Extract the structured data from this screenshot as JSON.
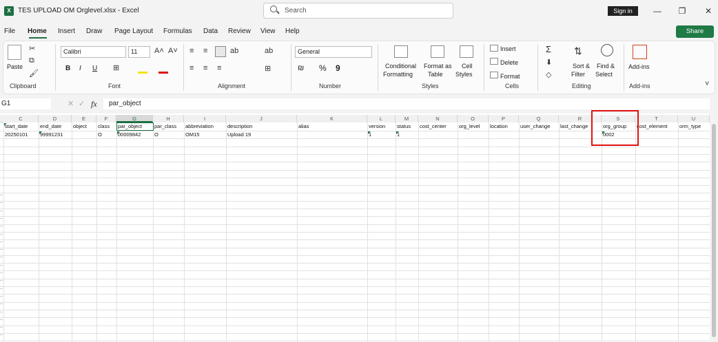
{
  "title_bar": {
    "logo": "X",
    "document_title": "TES UPLOAD OM Orglevel.xlsx  -  Excel",
    "search_placeholder": "Search",
    "sign_in": "Sign in",
    "minimize": "—",
    "restore": "❐",
    "close": "✕"
  },
  "menu": {
    "items": [
      "File",
      "Home",
      "Insert",
      "Draw",
      "Page Layout",
      "Formulas",
      "Data",
      "Review",
      "View",
      "Help"
    ],
    "share": "Share"
  },
  "ribbon": {
    "clipboard": {
      "label": "Clipboard",
      "paste": "Paste"
    },
    "font": {
      "label": "Font",
      "font_name": "Calibri",
      "font_size": "11",
      "bold": "B",
      "italic": "I",
      "underline": "U"
    },
    "alignment": {
      "label": "Alignment"
    },
    "number": {
      "label": "Number",
      "format": "General",
      "percent": "%",
      "comma": "9"
    },
    "styles": {
      "label": "Styles",
      "conditional": "Conditional",
      "formatting": "Formatting",
      "format_as": "Format as",
      "table": "Table",
      "cell": "Cell",
      "cell_styles": "Styles"
    },
    "cells": {
      "label": "Cells",
      "insert": "Insert",
      "delete": "Delete",
      "format": "Format"
    },
    "editing": {
      "label": "Editing",
      "sort": "Sort &",
      "filter": "Filter",
      "find": "Find &",
      "select": "Select"
    },
    "addins": {
      "label": "Add-ins",
      "button": "Add-ins"
    }
  },
  "formula_bar": {
    "name_box": "G1",
    "fx": "fx",
    "content": "par_object"
  },
  "columns": [
    "C",
    "D",
    "E",
    "F",
    "G",
    "H",
    "I",
    "J",
    "K",
    "L",
    "M",
    "N",
    "O",
    "P",
    "Q",
    "R",
    "S",
    "T",
    "U"
  ],
  "header_row": [
    "start_date",
    "end_date",
    "object",
    "class",
    "par_object",
    "par_class",
    "abbreviation",
    "description",
    "alias",
    "version",
    "status",
    "cost_center",
    "org_level",
    "location",
    "user_change",
    "last_change",
    "org_group",
    "cost_element",
    "orm_type"
  ],
  "data_row": [
    "20250101",
    "99991231",
    "",
    "O",
    "00009842",
    "O",
    "OM15",
    "Upload 19",
    "",
    "1",
    "1",
    "",
    "",
    "",
    "",
    "",
    "0002",
    "",
    ""
  ],
  "colors": {
    "accent": "#1d6f42",
    "highlight": "#e01010"
  }
}
